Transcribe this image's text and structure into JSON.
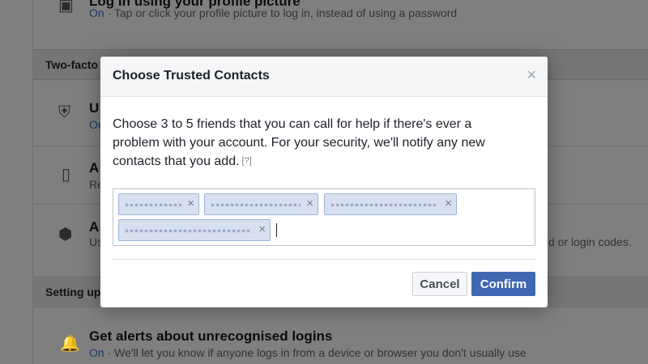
{
  "background": {
    "top_item": {
      "title": "Log in using your profile picture",
      "status": "On",
      "description": "· Tap or click your profile picture to log in, instead of using a password"
    },
    "section1_header": "Two-facto",
    "item_u": {
      "letter": "U",
      "status": "On"
    },
    "item_a1": {
      "letter": "A",
      "sub": "Re"
    },
    "item_a2": {
      "letter": "A",
      "sub": "Us",
      "right_text": "d or login codes."
    },
    "section2_header": "Setting up",
    "alerts_item": {
      "title": "Get alerts about unrecognised logins",
      "status": "On",
      "description": "· We'll let you know if anyone logs in from a device or browser you don't usually use"
    }
  },
  "modal": {
    "title": "Choose Trusted Contacts",
    "close_glyph": "×",
    "body_text": "Choose 3 to 5 friends that you can call for help if there's ever a problem with your account. For your security, we'll notify any new contacts that you add.",
    "help_link": "[?]",
    "token_remove_glyph": "×",
    "cancel_label": "Cancel",
    "confirm_label": "Confirm"
  },
  "colors": {
    "primary": "#4267b2",
    "token_bg": "#d8e0ef",
    "token_border": "#9cb4d8"
  }
}
